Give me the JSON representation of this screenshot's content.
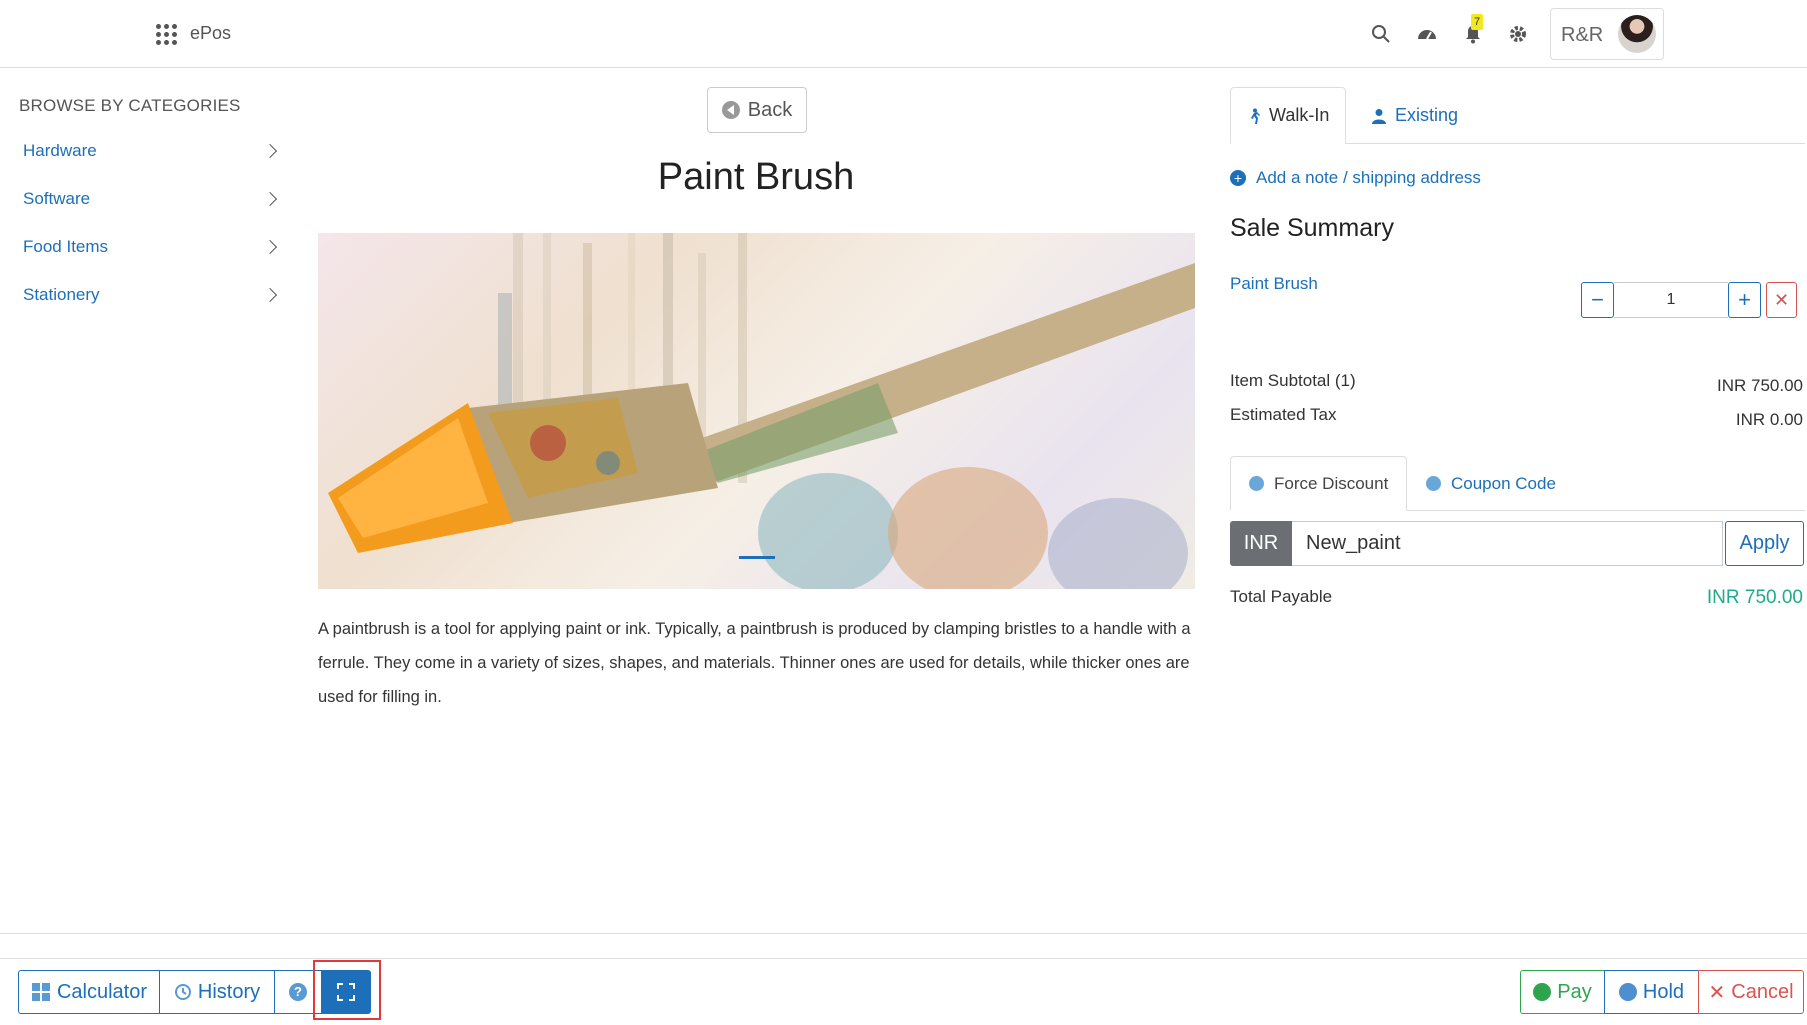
{
  "header": {
    "app_name": "ePos",
    "notification_count": "7",
    "user_name": "R&R",
    "icons": [
      "apps-grid-icon",
      "search-icon",
      "dashboard-icon",
      "bell-icon",
      "gear-icon"
    ]
  },
  "sidebar": {
    "title": "BROWSE BY CATEGORIES",
    "items": [
      {
        "label": "Hardware"
      },
      {
        "label": "Software"
      },
      {
        "label": "Food Items"
      },
      {
        "label": "Stationery"
      }
    ]
  },
  "product": {
    "back_label": "Back",
    "title": "Paint Brush",
    "description": "A paintbrush is a tool for applying paint or ink. Typically, a paintbrush is produced by clamping bristles to a handle with a ferrule. They come in a variety of sizes, shapes, and materials. Thinner ones are used for details, while thicker ones are used for filling in."
  },
  "customer_tabs": {
    "walk_in": "Walk-In",
    "existing": "Existing"
  },
  "cart": {
    "add_note": "Add a note / shipping address",
    "summary_title": "Sale Summary",
    "line_item": {
      "name": "Paint Brush",
      "quantity": "1"
    },
    "item_subtotal_label": "Item Subtotal (1)",
    "item_subtotal_value": "INR 750.00",
    "tax_label": "Estimated Tax",
    "tax_value": "INR 0.00",
    "discount_tabs": {
      "force": "Force Discount",
      "coupon": "Coupon Code"
    },
    "discount_currency": "INR",
    "discount_value": "New_paint",
    "apply_label": "Apply",
    "total_label": "Total Payable",
    "total_value": "INR 750.00",
    "total_color": "#1faa8c"
  },
  "footer": {
    "calculator": "Calculator",
    "history": "History",
    "help": "?",
    "pay": "Pay",
    "hold": "Hold",
    "cancel": "Cancel"
  },
  "colors": {
    "accent": "#1c6fb8",
    "pay": "#2ea44f",
    "cancel": "#d9534f",
    "highlight": "#e03a3a"
  }
}
